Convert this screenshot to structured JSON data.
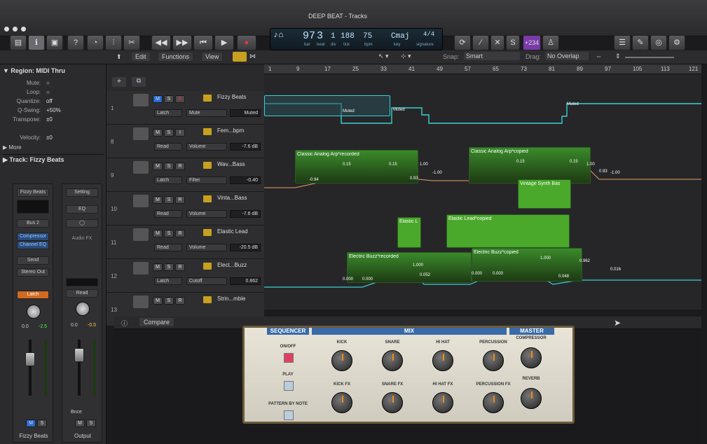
{
  "window": {
    "title": "DEEP BEAT - Tracks"
  },
  "lcd": {
    "tempo": "97",
    "beat": "3",
    "div": "1",
    "tick": "188",
    "bpm": "75",
    "key": "Cmaj",
    "signature": "4/4",
    "l_bar": "bar",
    "l_beat": "beat",
    "l_div": "div",
    "l_tick": "tick",
    "l_bpm": "bpm",
    "l_key": "key",
    "l_sig": "signature"
  },
  "cpu": "+234",
  "menus": {
    "edit": "Edit",
    "functions": "Functions",
    "view": "View",
    "snap_label": "Snap:",
    "snap": "Smart",
    "drag_label": "Drag:",
    "drag": "No Overlap"
  },
  "region_inspector": {
    "header": "Region: MIDI Thru",
    "params": [
      {
        "k": "Mute:",
        "v": ""
      },
      {
        "k": "Loop:",
        "v": ""
      },
      {
        "k": "Quantize:",
        "v": "off"
      },
      {
        "k": "Q-Swing:",
        "v": "+50%"
      },
      {
        "k": "Transpose:",
        "v": "±0"
      },
      {
        "k": "Velocity:",
        "v": "±0"
      }
    ],
    "more": "More",
    "track": "Track:  Fizzy Beats"
  },
  "strips": [
    {
      "setting": "Fizzy Beats",
      "bus": "Bus 2",
      "fx1": "Compressor",
      "fx2": "Channel EQ",
      "send": "Send",
      "out": "Stereo Out",
      "auto": "Latch",
      "v1": "0.0",
      "v2": "-2.5",
      "name": "Fizzy Beats"
    },
    {
      "setting": "Setting",
      "eq": "EQ",
      "fx": "Audio FX",
      "auto": "Read",
      "v1": "0.0",
      "v2": "-0.5",
      "extra": "Bnce",
      "name": "Output"
    }
  ],
  "tracks": [
    {
      "num": "1",
      "name": "Fizzy Beats",
      "mode": "Latch",
      "param": "Mute",
      "val": "Muted"
    },
    {
      "num": "8",
      "name": "Fem...bpm",
      "mode": "Read",
      "param": "Volume",
      "val": "-7.6 dB"
    },
    {
      "num": "9",
      "name": "Wav...Bass",
      "mode": "Latch",
      "param": "Filter",
      "val": "-0.40"
    },
    {
      "num": "10",
      "name": "Vinta...Bass",
      "mode": "Read",
      "param": "Volume",
      "val": "-7.6 dB"
    },
    {
      "num": "11",
      "name": "Elastic Lead",
      "mode": "Read",
      "param": "Volume",
      "val": "-20.5 dB"
    },
    {
      "num": "12",
      "name": "Elect...Buzz",
      "mode": "Latch",
      "param": "Cutoff",
      "val": "0.862"
    },
    {
      "num": "13",
      "name": "Strin...mble",
      "mode": "",
      "param": "",
      "val": ""
    }
  ],
  "ruler": [
    "1",
    "9",
    "17",
    "25",
    "33",
    "41",
    "49",
    "57",
    "65",
    "73",
    "81",
    "89",
    "97",
    "105",
    "113",
    "121"
  ],
  "regions": {
    "muted": "Muted",
    "arp1": "Classic Analog Arp*recorded",
    "arp2": "Classic Analog Arp*copied",
    "vintage": "Vintage Synth Bas",
    "el1": "Elastic L",
    "el2": "Elastic Lead*copied",
    "buzz1": "Electric Buzz*recorded",
    "buzz2": "Electric Buzz*copied"
  },
  "points": {
    "p1": "0.15",
    "p2": "0.15",
    "p3": "1.00",
    "p4": "-0.94",
    "p5": "0.93",
    "p6": "-1.00",
    "p7": "0.15",
    "p8": "0.15",
    "p9": "1.00",
    "p10": "0.93",
    "p11": "-1.00",
    "p12": "1.000",
    "p13": "0.000",
    "p14": "0.000",
    "p15": "0.052",
    "p16": "0.000",
    "p17": "0.000",
    "p18": "1.000",
    "p19": "0.048",
    "p20": "0.962",
    "p21": "0.016"
  },
  "plugin": {
    "compare": "Compare",
    "sequencer": "SEQUENCER",
    "mix": "MIX",
    "master": "MASTER",
    "onoff": "ON/OFF",
    "play": "PLAY",
    "pattern": "PATTERN BY NOTE",
    "knobs": [
      "KICK",
      "SNARE",
      "HI HAT",
      "PERCUSSION",
      "KICK FX",
      "SNARE FX",
      "HI HAT FX",
      "PERCUSSION FX"
    ],
    "compressor": "COMPRESSOR",
    "reverb": "REVERB"
  }
}
